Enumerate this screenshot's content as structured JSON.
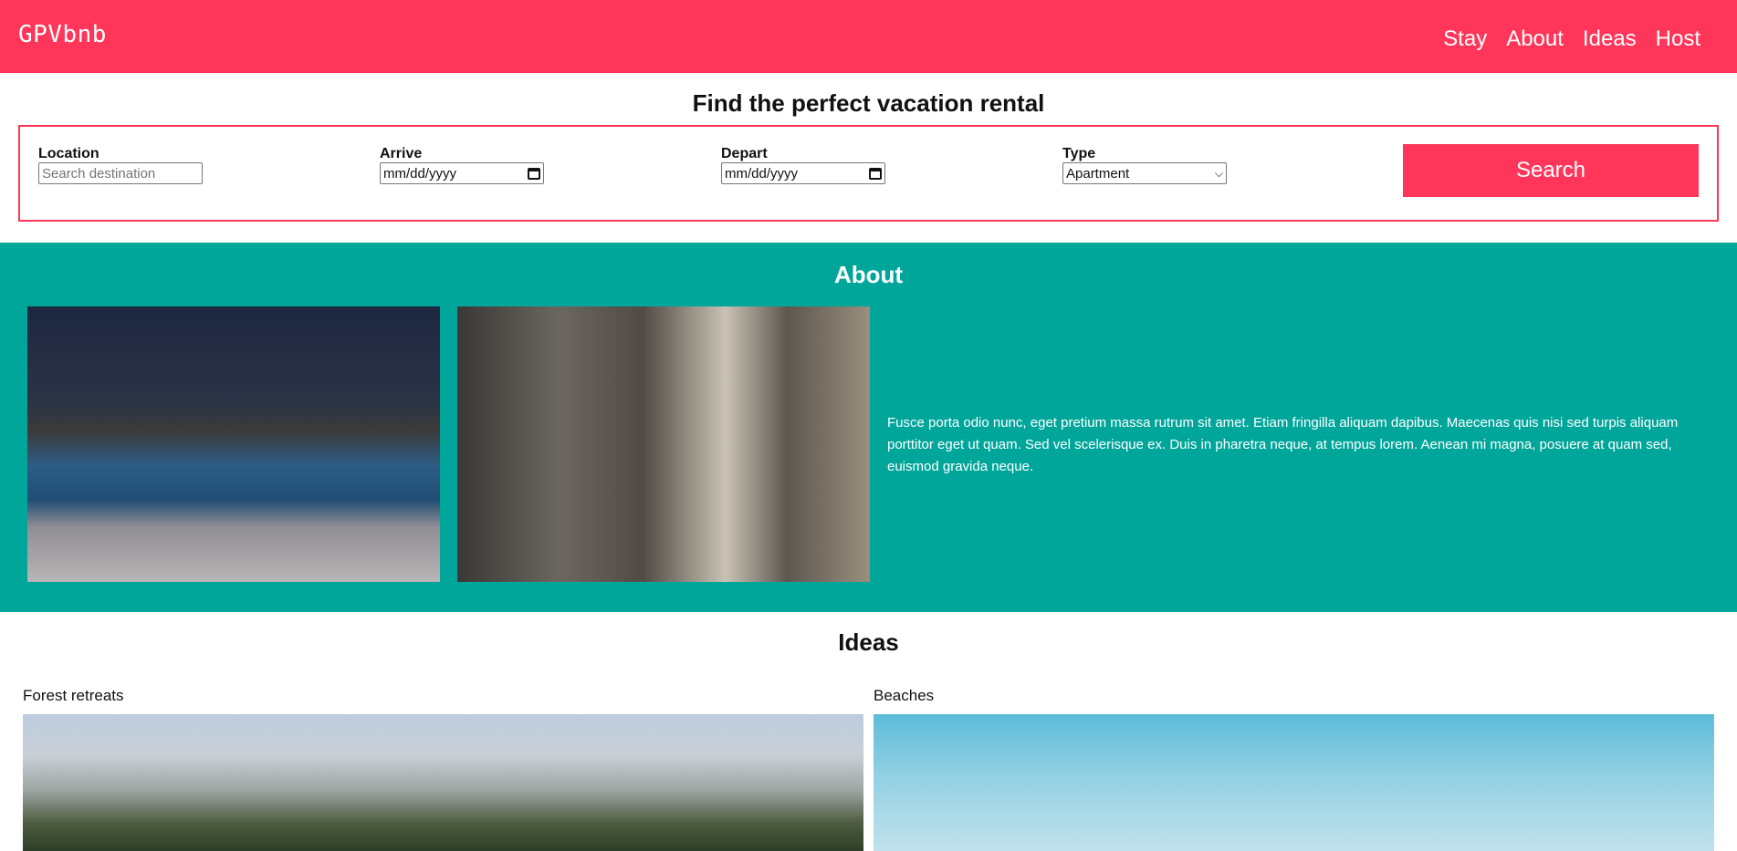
{
  "header": {
    "logo": "GPVbnb",
    "nav": [
      "Stay",
      "About",
      "Ideas",
      "Host"
    ]
  },
  "search": {
    "title": "Find the perfect vacation rental",
    "location_label": "Location",
    "location_placeholder": "Search destination",
    "arrive_label": "Arrive",
    "arrive_value": "mm/dd/yyyy",
    "depart_label": "Depart",
    "depart_value": "mm/dd/yyyy",
    "type_label": "Type",
    "type_value": "Apartment",
    "button": "Search"
  },
  "about": {
    "title": "About",
    "text": "Fusce porta odio nunc, eget pretium massa rutrum sit amet. Etiam fringilla aliquam dapibus. Maecenas quis nisi sed turpis aliquam porttitor eget ut quam. Sed vel scelerisque ex. Duis in pharetra neque, at tempus lorem. Aenean mi magna, posuere at quam sed, euismod gravida neque."
  },
  "ideas": {
    "title": "Ideas",
    "items": [
      "Forest retreats",
      "Beaches"
    ]
  },
  "colors": {
    "brand": "#ff3659",
    "teal": "#01a69b"
  }
}
